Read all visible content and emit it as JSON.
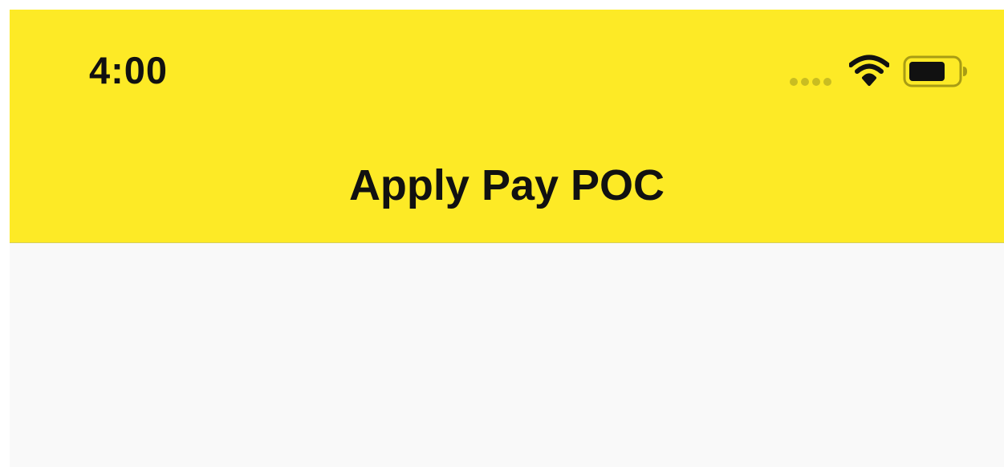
{
  "status_bar": {
    "time": "4:00",
    "signal_icon": "cellular-signal-dots-icon",
    "wifi_icon": "wifi-icon",
    "battery_icon": "battery-icon"
  },
  "nav_bar": {
    "title": "Apply Pay POC"
  },
  "colors": {
    "header_bg": "#FDEA26",
    "content_bg": "#F9F9F9",
    "text": "#111111",
    "signal_dots": "#C9BD21",
    "battery_outline": "#A89C14",
    "header_divider": "#D6CF5A"
  }
}
